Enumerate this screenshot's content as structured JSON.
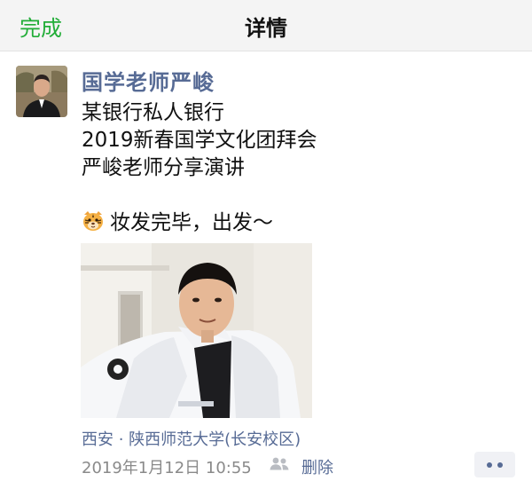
{
  "nav": {
    "done_label": "完成",
    "title": "详情"
  },
  "post": {
    "author": "国学老师严峻",
    "text_lines": [
      "某银行私人银行",
      "2019新春国学文化团拜会",
      "严峻老师分享演讲",
      "",
      "妆发完毕，出发～"
    ],
    "emoji_icon": "tiger-face-icon",
    "location": "西安 · 陕西师范大学(长安校区)",
    "timestamp": "2019年1月12日 10:55",
    "delete_label": "删除",
    "visibility_icon": "friends-icon",
    "more_icon": "more-dots-icon"
  },
  "colors": {
    "accent_green": "#22ad38",
    "link_blue": "#576b95",
    "meta_gray": "#8a8a8a",
    "nav_bg": "#f4f4f4"
  }
}
